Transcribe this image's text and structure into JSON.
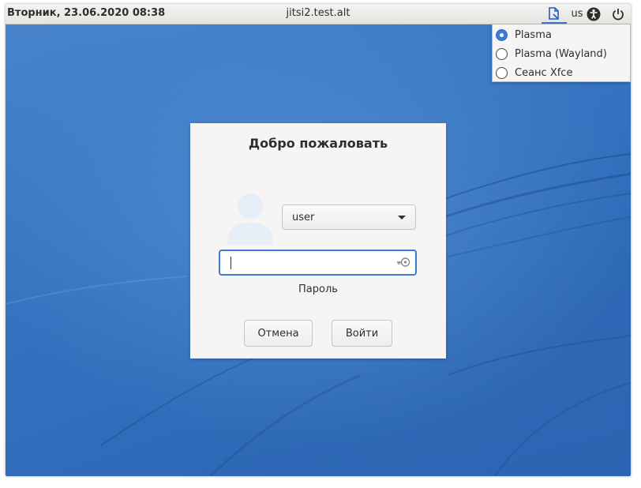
{
  "panel": {
    "clock": "Вторник, 23.06.2020 08:38",
    "hostname": "jitsi2.test.alt",
    "session_icon": "session-document-icon",
    "keyboard_layout": "us",
    "accessibility_icon": "accessibility-icon",
    "power_icon": "power-icon"
  },
  "session_menu": {
    "items": [
      {
        "label": "Plasma",
        "checked": true
      },
      {
        "label": "Plasma (Wayland)",
        "checked": false
      },
      {
        "label": "Сеанс Xfce",
        "checked": false
      }
    ]
  },
  "dialog": {
    "title": "Добро пожаловать",
    "avatar_icon": "user-avatar-icon",
    "user_select": {
      "value": "user"
    },
    "password": {
      "value": "",
      "label": "Пароль",
      "icon": "key-icon"
    },
    "buttons": {
      "cancel": "Отмена",
      "login": "Войти"
    }
  },
  "colors": {
    "accent": "#3a7bd5",
    "desktop": "#3473c0",
    "panel": "#eceae7",
    "dialog": "#f6f5f4"
  }
}
